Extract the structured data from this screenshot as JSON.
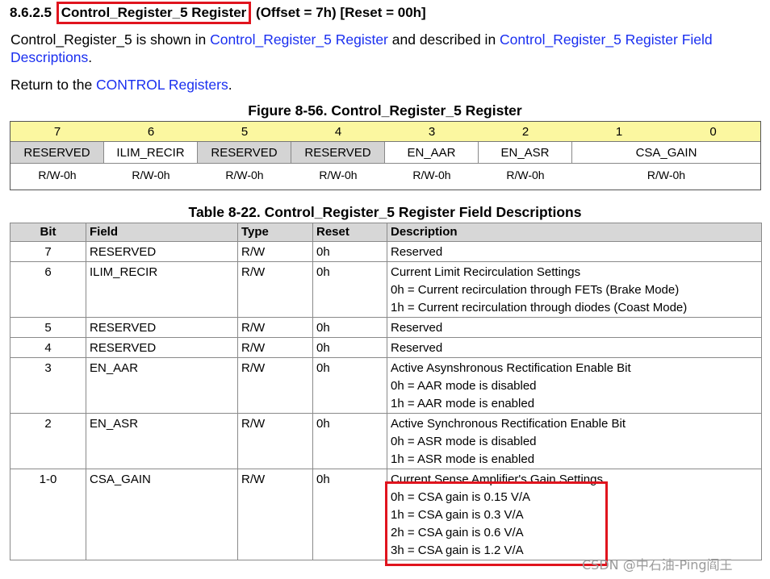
{
  "heading": {
    "number": "8.6.2.5",
    "title": "Control_Register_5 Register",
    "suffix": "(Offset = 7h) [Reset = 00h]"
  },
  "para1": {
    "text1": "Control_Register_5 is shown in ",
    "link1": "Control_Register_5 Register",
    "text2": " and described in ",
    "link2": "Control_Register_5 Register Field Descriptions",
    "text3": "."
  },
  "para2": {
    "text1": "Return to the ",
    "link": "CONTROL Registers",
    "text2": "."
  },
  "figure": {
    "caption": "Figure 8-56. Control_Register_5 Register",
    "bits": [
      "7",
      "6",
      "5",
      "4",
      "3",
      "2",
      "1",
      "0"
    ],
    "fields": [
      "RESERVED",
      "ILIM_RECIR",
      "RESERVED",
      "RESERVED",
      "EN_AAR",
      "EN_ASR",
      "CSA_GAIN"
    ],
    "access": [
      "R/W-0h",
      "R/W-0h",
      "R/W-0h",
      "R/W-0h",
      "R/W-0h",
      "R/W-0h",
      "R/W-0h"
    ]
  },
  "table": {
    "caption": "Table 8-22. Control_Register_5 Register Field Descriptions",
    "headers": [
      "Bit",
      "Field",
      "Type",
      "Reset",
      "Description"
    ],
    "rows": [
      {
        "bit": "7",
        "field": "RESERVED",
        "type": "R/W",
        "reset": "0h",
        "desc": [
          "Reserved"
        ]
      },
      {
        "bit": "6",
        "field": "ILIM_RECIR",
        "type": "R/W",
        "reset": "0h",
        "desc": [
          "Current Limit Recirculation Settings",
          "0h = Current recirculation through FETs (Brake Mode)",
          "1h = Current recirculation through diodes (Coast Mode)"
        ]
      },
      {
        "bit": "5",
        "field": "RESERVED",
        "type": "R/W",
        "reset": "0h",
        "desc": [
          "Reserved"
        ]
      },
      {
        "bit": "4",
        "field": "RESERVED",
        "type": "R/W",
        "reset": "0h",
        "desc": [
          "Reserved"
        ]
      },
      {
        "bit": "3",
        "field": "EN_AAR",
        "type": "R/W",
        "reset": "0h",
        "desc": [
          "Active Asynshronous Rectification Enable Bit",
          "0h = AAR mode is disabled",
          "1h = AAR mode is enabled"
        ]
      },
      {
        "bit": "2",
        "field": "EN_ASR",
        "type": "R/W",
        "reset": "0h",
        "desc": [
          "Active Synchronous Rectification Enable Bit",
          "0h = ASR mode is disabled",
          "1h = ASR mode is enabled"
        ]
      },
      {
        "bit": "1-0",
        "field": "CSA_GAIN",
        "type": "R/W",
        "reset": "0h",
        "desc": [
          "Current Sense Amplifier's Gain Settings",
          "0h = CSA gain is 0.15 V/A",
          "1h = CSA gain is 0.3 V/A",
          "2h = CSA gain is 0.6 V/A",
          "3h = CSA gain is 1.2 V/A"
        ]
      }
    ]
  },
  "watermark": "CSDN @中石油-Ping阎王",
  "colors": {
    "link": "#1a2ff0",
    "highlight": "#e0141e",
    "bit_row": "#fbf7a0",
    "reserved_bg": "#d4d4d4",
    "header_bg": "#d7d7d7"
  }
}
